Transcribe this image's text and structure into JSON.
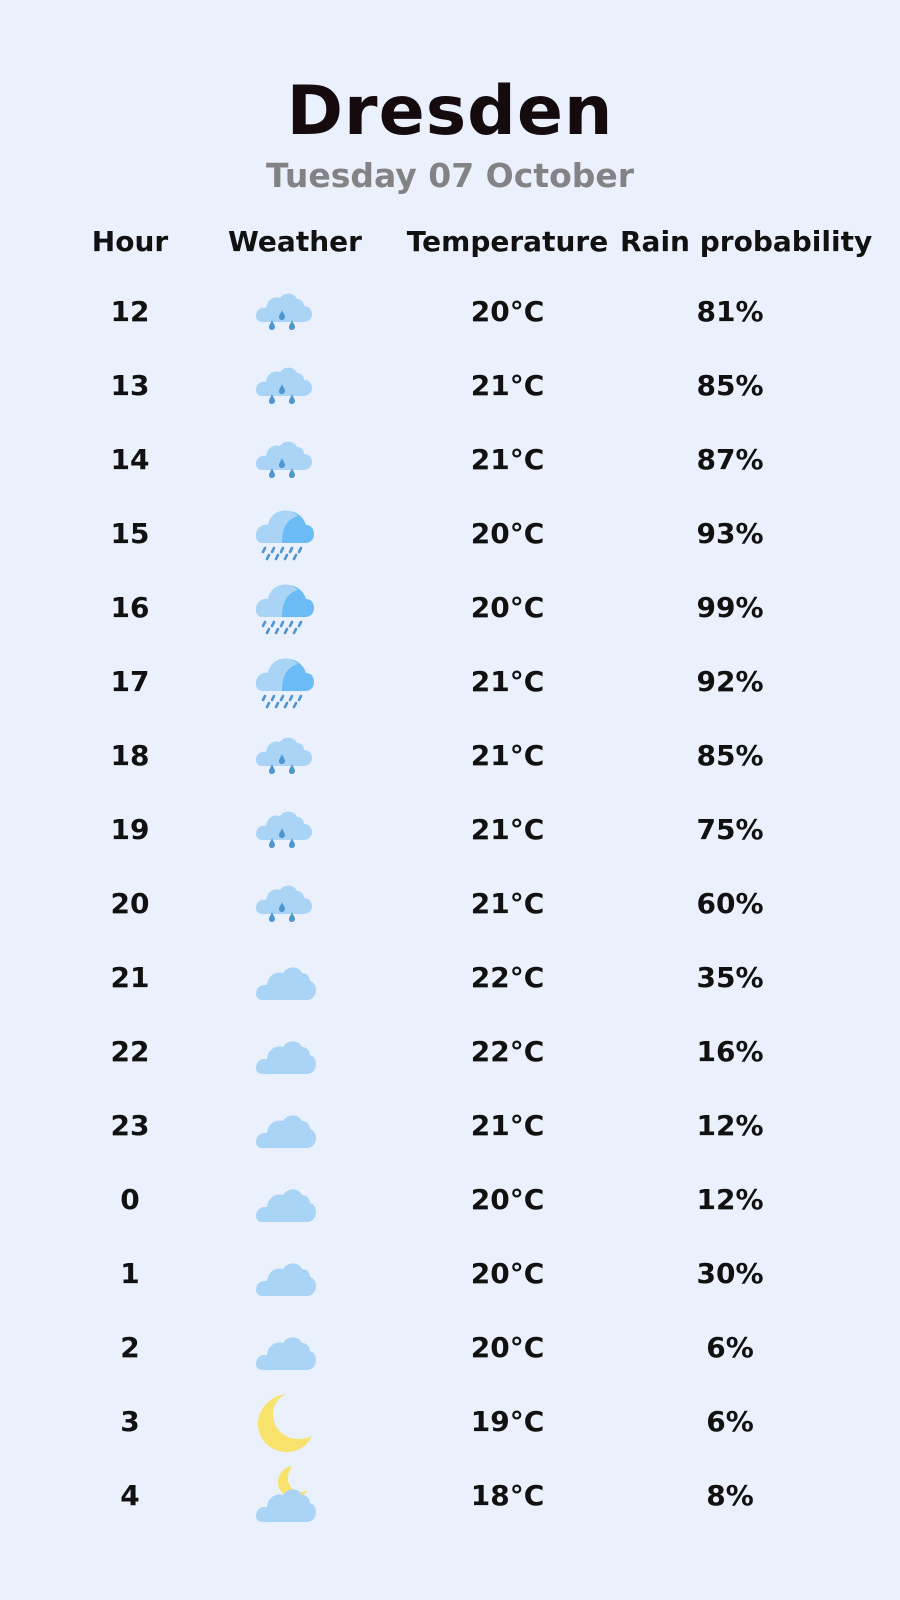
{
  "header": {
    "city": "Dresden",
    "date": "Tuesday 07 October"
  },
  "columns": {
    "hour": "Hour",
    "weather": "Weather",
    "temperature": "Temperature",
    "rain": "Rain probability"
  },
  "colors": {
    "background": "#eaf1fd",
    "cloud_light": "#a9d4f6",
    "cloud_dark": "#6bbcf6",
    "raindrop": "#4f95cf",
    "moon": "#f8e26c"
  },
  "rows": [
    {
      "hour": "12",
      "icon": "light-rain-cloud-icon",
      "temp": "20°C",
      "rain": "81%"
    },
    {
      "hour": "13",
      "icon": "light-rain-cloud-icon",
      "temp": "21°C",
      "rain": "85%"
    },
    {
      "hour": "14",
      "icon": "light-rain-cloud-icon",
      "temp": "21°C",
      "rain": "87%"
    },
    {
      "hour": "15",
      "icon": "heavy-rain-cloud-icon",
      "temp": "20°C",
      "rain": "93%"
    },
    {
      "hour": "16",
      "icon": "heavy-rain-cloud-icon",
      "temp": "20°C",
      "rain": "99%"
    },
    {
      "hour": "17",
      "icon": "heavy-rain-cloud-icon",
      "temp": "21°C",
      "rain": "92%"
    },
    {
      "hour": "18",
      "icon": "light-rain-cloud-icon",
      "temp": "21°C",
      "rain": "85%"
    },
    {
      "hour": "19",
      "icon": "light-rain-cloud-icon",
      "temp": "21°C",
      "rain": "75%"
    },
    {
      "hour": "20",
      "icon": "light-rain-cloud-icon",
      "temp": "21°C",
      "rain": "60%"
    },
    {
      "hour": "21",
      "icon": "cloud-icon",
      "temp": "22°C",
      "rain": "35%"
    },
    {
      "hour": "22",
      "icon": "cloud-icon",
      "temp": "22°C",
      "rain": "16%"
    },
    {
      "hour": "23",
      "icon": "cloud-icon",
      "temp": "21°C",
      "rain": "12%"
    },
    {
      "hour": "0",
      "icon": "cloud-icon",
      "temp": "20°C",
      "rain": "12%"
    },
    {
      "hour": "1",
      "icon": "cloud-icon",
      "temp": "20°C",
      "rain": "30%"
    },
    {
      "hour": "2",
      "icon": "cloud-icon",
      "temp": "20°C",
      "rain": "6%"
    },
    {
      "hour": "3",
      "icon": "moon-icon",
      "temp": "19°C",
      "rain": "6%"
    },
    {
      "hour": "4",
      "icon": "moon-cloud-icon",
      "temp": "18°C",
      "rain": "8%"
    }
  ]
}
